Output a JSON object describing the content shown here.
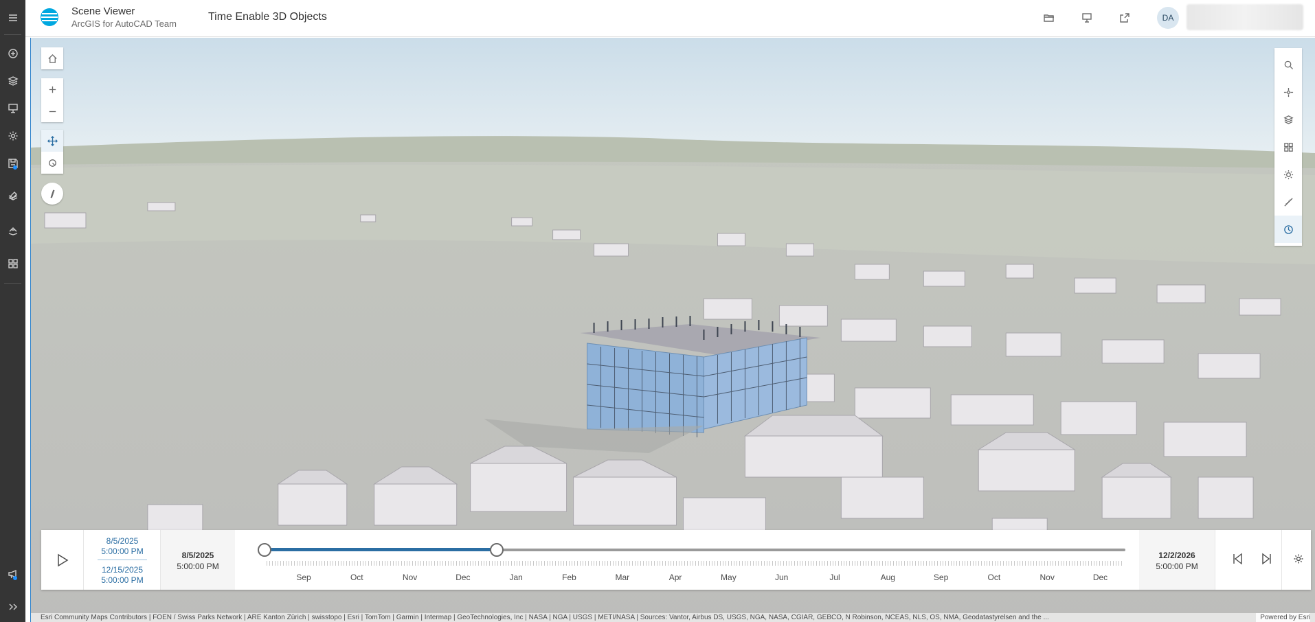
{
  "header": {
    "app_title": "Scene Viewer",
    "app_subtitle": "ArcGIS for AutoCAD Team",
    "scene_title": "Time Enable 3D Objects",
    "user_initials": "DA",
    "buttons": [
      "folder-open-icon",
      "presentation-icon",
      "share-icon"
    ]
  },
  "left_rail": {
    "items": [
      "menu-icon",
      "add-layer-icon",
      "layers-icon",
      "slides-icon",
      "settings-icon",
      "save-icon",
      "analysis-icon",
      "tools-icon",
      "apps-icon",
      "announcement-icon",
      "expand-icon"
    ]
  },
  "view_controls": {
    "left": [
      "home-icon",
      "zoom-in-icon",
      "zoom-out-icon",
      "pan-icon",
      "rotate-icon",
      "compass-icon"
    ],
    "right": [
      "search-icon",
      "locate-icon",
      "layers-icon",
      "basemap-icon",
      "daylight-icon",
      "measure-icon",
      "time-icon"
    ]
  },
  "time_slider": {
    "range_start_date": "8/5/2025",
    "range_start_time": "5:00:00 PM",
    "range_end_date": "12/15/2025",
    "range_end_time": "5:00:00 PM",
    "start_date": "8/5/2025",
    "start_time": "5:00:00 PM",
    "end_date": "12/2/2026",
    "end_time": "5:00:00 PM",
    "months": [
      "Sep",
      "Oct",
      "Nov",
      "Dec",
      "Jan",
      "Feb",
      "Mar",
      "Apr",
      "May",
      "Jun",
      "Jul",
      "Aug",
      "Sep",
      "Oct",
      "Nov",
      "Dec"
    ],
    "selection_start_fraction": 0.0,
    "selection_end_fraction": 0.27
  },
  "attribution": {
    "text": "Esri Community Maps Contributors | FOEN / Swiss Parks Network | ARE Kanton Zürich | swisstopo | Esri | TomTom | Garmin | Intermap | GeoTechnologies, Inc | NASA | NGA | USGS | METI/NASA | Sources: Vantor, Airbus DS, USGS, NGA, NASA, CGIAR, GEBCO, N Robinson, NCEAS, NLS, OS, NMA, Geodatastyrelsen and the ...",
    "powered": "Powered by Esri"
  },
  "colors": {
    "accent": "#2b6ea3",
    "rail": "#353535",
    "sky_top": "#d3e2ec",
    "ground": "#c9cbc6",
    "building_glass": "#8fb2d8"
  }
}
